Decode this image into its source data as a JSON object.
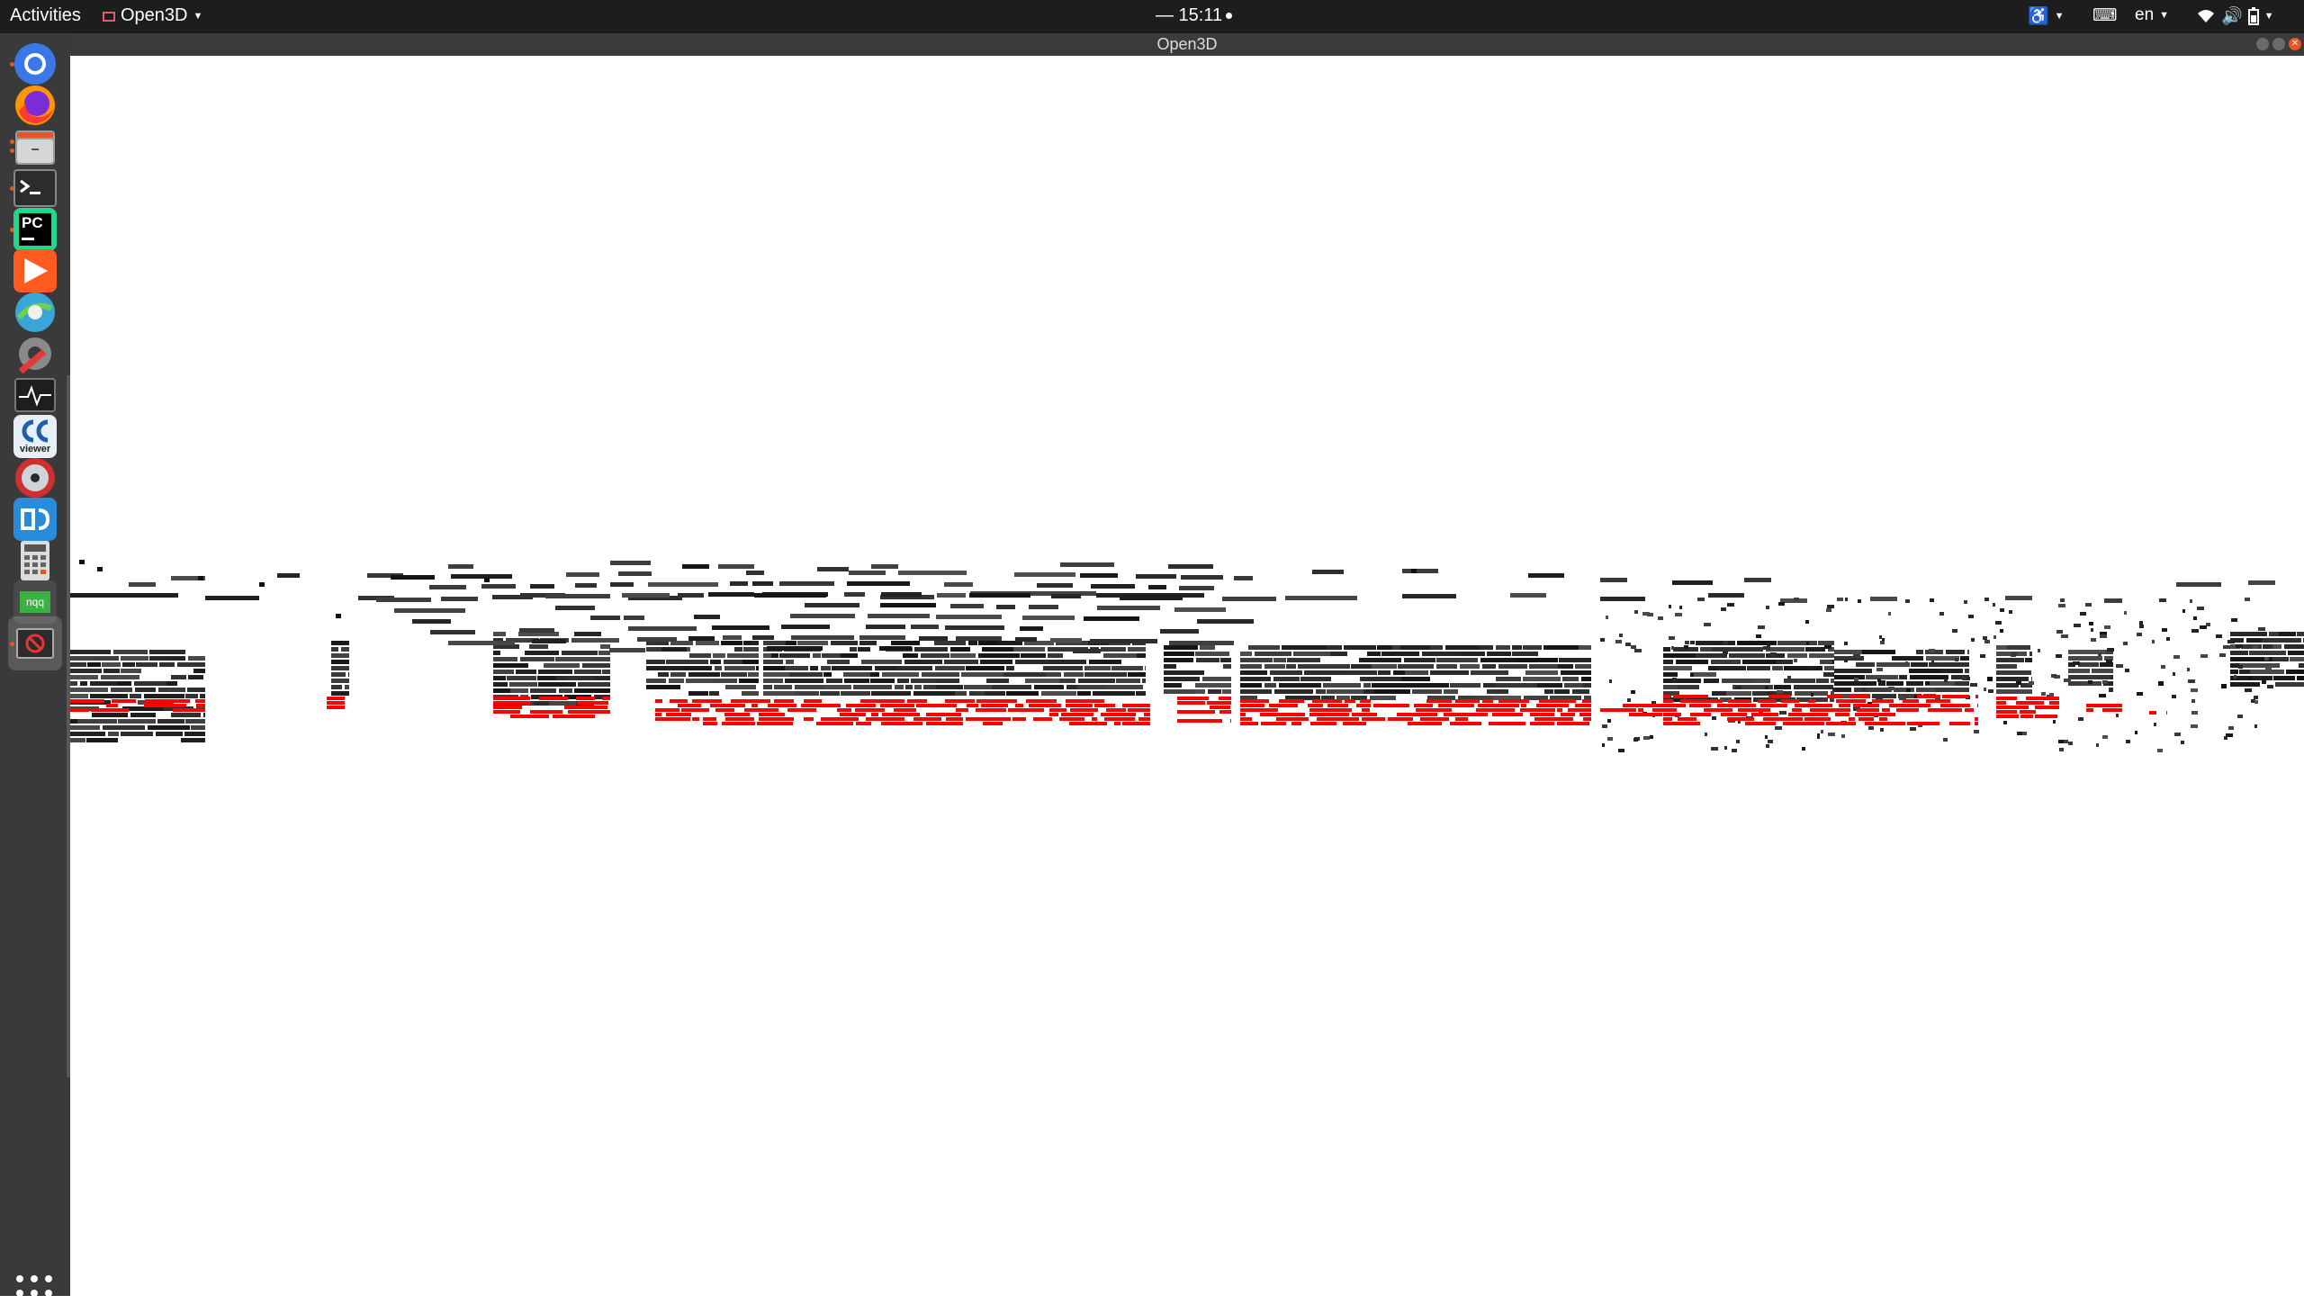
{
  "topbar": {
    "activities": "Activities",
    "app_menu": "Open3D",
    "clock": "— 15:11",
    "keyboard_lang": "en"
  },
  "window": {
    "title": "Open3D"
  },
  "dock": {
    "items": [
      {
        "name": "Chromium",
        "icon": "chromium-icon"
      },
      {
        "name": "Firefox",
        "icon": "firefox-icon"
      },
      {
        "name": "Files",
        "icon": "files-icon"
      },
      {
        "name": "Terminal",
        "icon": "terminal-icon"
      },
      {
        "name": "PyCharm",
        "icon": "pycharm-icon",
        "text": "PC"
      },
      {
        "name": "Media Player",
        "icon": "media-player-icon"
      },
      {
        "name": "Network Tool",
        "icon": "network-icon"
      },
      {
        "name": "Settings",
        "icon": "tools-icon"
      },
      {
        "name": "System Monitor",
        "icon": "system-monitor-icon"
      },
      {
        "name": "CloudCompare Viewer",
        "icon": "ccviewer-icon",
        "text": "viewer"
      },
      {
        "name": "Disc Burner",
        "icon": "disc-icon"
      },
      {
        "name": "Software Updater",
        "icon": "updater-icon"
      },
      {
        "name": "Calculator",
        "icon": "calculator-icon"
      },
      {
        "name": "Note App",
        "icon": "nqq-icon",
        "text": "nqq"
      },
      {
        "name": "Open3D",
        "icon": "open3d-window-icon"
      }
    ]
  },
  "colors": {
    "topbar": "#1d1d1d",
    "dock": "#3a3a3a",
    "accent": "#e95420",
    "ground_points": "#ff0000",
    "object_points": "#1a1a1a"
  },
  "scene": {
    "type": "point-cloud",
    "description_points": "lidar scan, ground highlighted red"
  }
}
